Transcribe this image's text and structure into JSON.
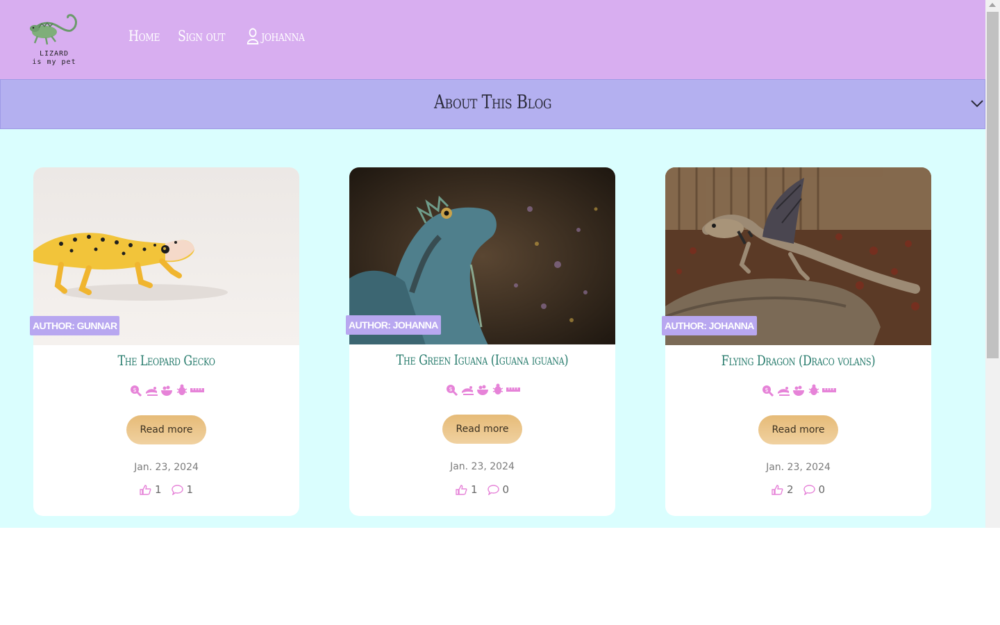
{
  "nav": {
    "logo_line1": "LIZARD",
    "logo_line2": "is my pet",
    "home": "Home",
    "signout": "Sign out",
    "user": "johanna"
  },
  "about": {
    "title": "About This Blog"
  },
  "posts": [
    {
      "author": "AUTHOR: GUNNAR",
      "title": "The Leopard Gecko",
      "readmore": "Read more",
      "date": "Jan. 23, 2024",
      "likes": "1",
      "comments": "1"
    },
    {
      "author": "AUTHOR: JOHANNA",
      "title": "The Green Iguana (Iguana iguana)",
      "readmore": "Read more",
      "date": "Jan. 23, 2024",
      "likes": "1",
      "comments": "0"
    },
    {
      "author": "AUTHOR: JOHANNA",
      "title": "Flying Dragon (Draco volans)",
      "readmore": "Read more",
      "date": "Jan. 23, 2024",
      "likes": "2",
      "comments": "0"
    }
  ],
  "icons": [
    "search-dollar-icon",
    "lizard-icon",
    "food-bowl-icon",
    "bug-icon",
    "ruler-icon"
  ],
  "colors": {
    "navbar": "#d8aef0",
    "about_bar": "#b4b0f0",
    "page_bg": "#dafefe",
    "title": "#257a6b",
    "badge": "#b8a7f0",
    "icon_pink": "#e683d8",
    "button": "#e6bb78"
  }
}
